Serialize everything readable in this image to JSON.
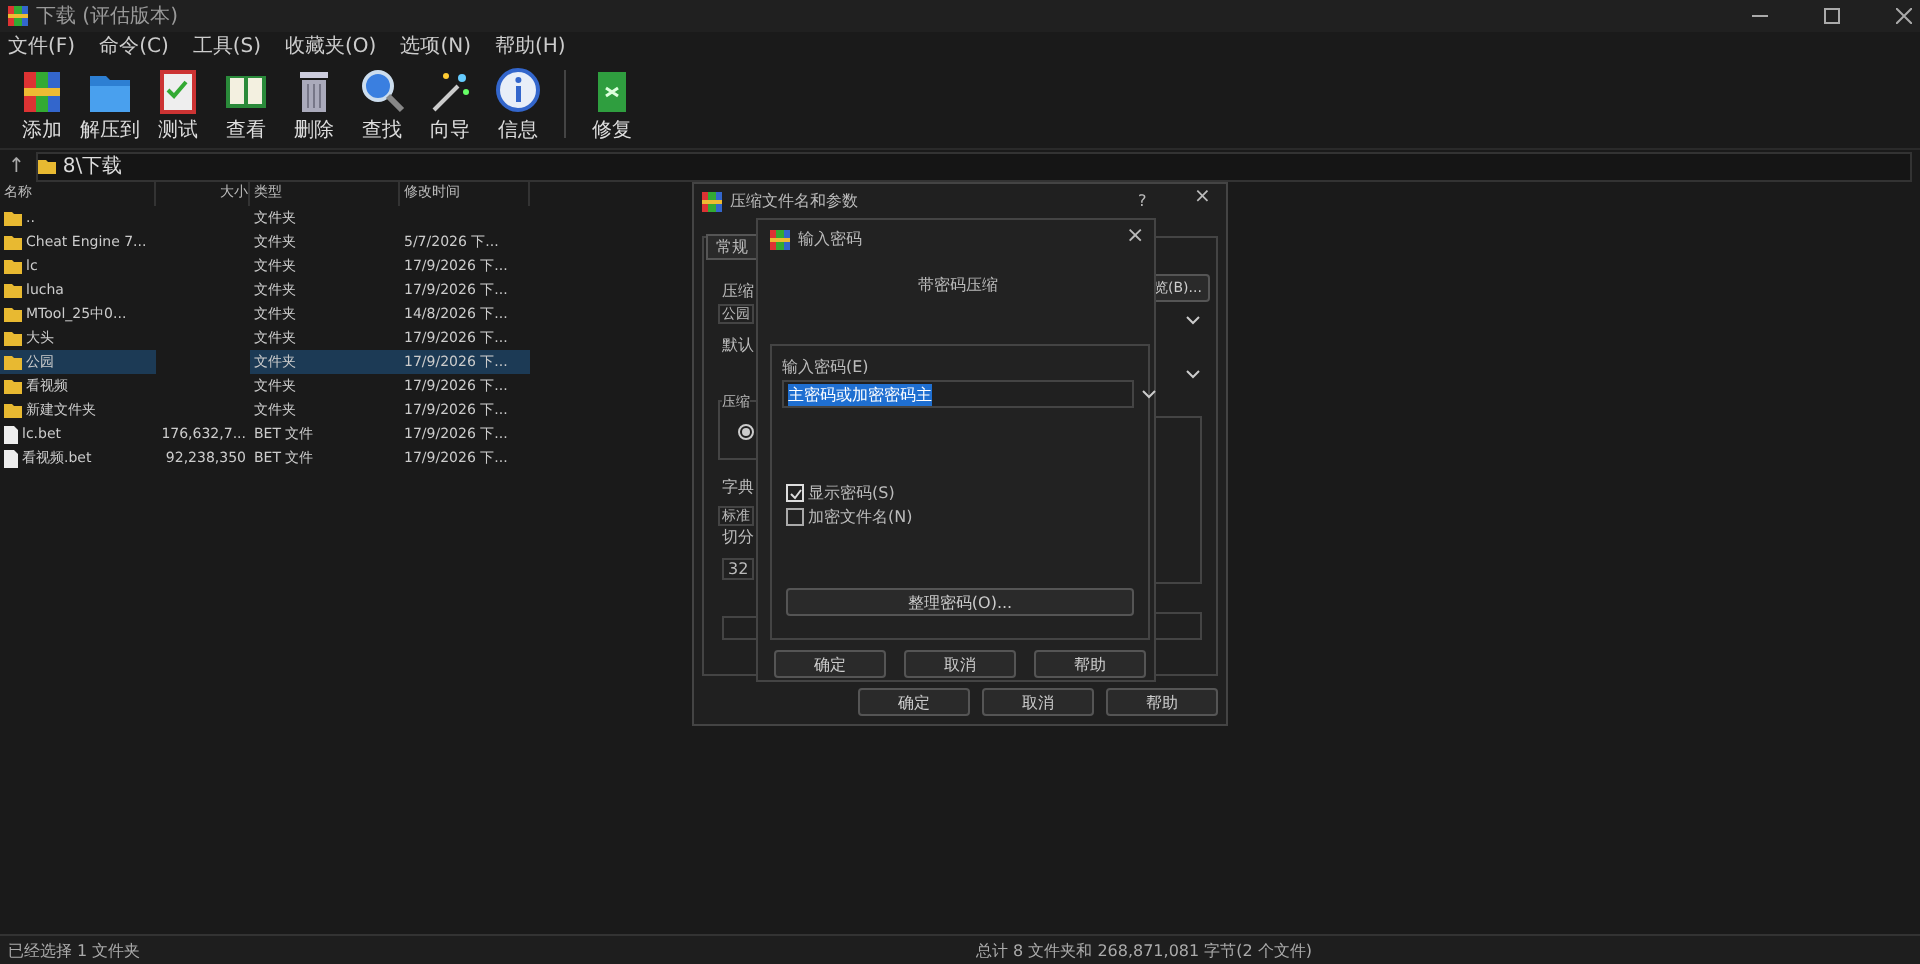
{
  "window": {
    "title": "下载 (评估版本)"
  },
  "menu": [
    "文件(F)",
    "命令(C)",
    "工具(S)",
    "收藏夹(O)",
    "选项(N)",
    "帮助(H)"
  ],
  "toolbar": [
    {
      "kind": "add",
      "label": "添加"
    },
    {
      "kind": "extract",
      "label": "解压到"
    },
    {
      "kind": "test",
      "label": "测试"
    },
    {
      "kind": "view",
      "label": "查看"
    },
    {
      "kind": "delete",
      "label": "删除"
    },
    {
      "kind": "find",
      "label": "查找"
    },
    {
      "kind": "wizard",
      "label": "向导"
    },
    {
      "kind": "info",
      "label": "信息"
    },
    {
      "kind": "repair",
      "label": "修复"
    }
  ],
  "address": {
    "up": "↑",
    "path": "8\\下载"
  },
  "table": {
    "columns": [
      "名称",
      "大小",
      "类型",
      "修改时间"
    ],
    "rows": [
      {
        "kind": "folder",
        "name": "..",
        "size": "",
        "type": "文件夹",
        "modified": "",
        "selected": false
      },
      {
        "kind": "folder",
        "name": "Cheat Engine 7...",
        "size": "",
        "type": "文件夹",
        "modified": "5/7/2026 下...",
        "selected": false
      },
      {
        "kind": "folder",
        "name": "lc",
        "size": "",
        "type": "文件夹",
        "modified": "17/9/2026 下...",
        "selected": false
      },
      {
        "kind": "folder",
        "name": "lucha",
        "size": "",
        "type": "文件夹",
        "modified": "17/9/2026 下...",
        "selected": false
      },
      {
        "kind": "folder",
        "name": "MTool_25中0...",
        "size": "",
        "type": "文件夹",
        "modified": "14/8/2026 下...",
        "selected": false
      },
      {
        "kind": "folder",
        "name": "大头",
        "size": "",
        "type": "文件夹",
        "modified": "17/9/2026 下...",
        "selected": false
      },
      {
        "kind": "folder",
        "name": "公园",
        "size": "",
        "type": "文件夹",
        "modified": "17/9/2026 下...",
        "selected": true
      },
      {
        "kind": "folder",
        "name": "看视频",
        "size": "",
        "type": "文件夹",
        "modified": "17/9/2026 下...",
        "selected": false
      },
      {
        "kind": "folder",
        "name": "新建文件夹",
        "size": "",
        "type": "文件夹",
        "modified": "17/9/2026 下...",
        "selected": false
      },
      {
        "kind": "file",
        "name": "lc.bet",
        "size": "176,632,7...",
        "type": "BET 文件",
        "modified": "17/9/2026 下...",
        "selected": false
      },
      {
        "kind": "file",
        "name": "看视频.bet",
        "size": "92,238,350",
        "type": "BET 文件",
        "modified": "17/9/2026 下...",
        "selected": false
      }
    ]
  },
  "archive_dialog": {
    "title": "压缩文件名和参数",
    "help": "?",
    "close": "×",
    "tab": "常规",
    "labels": [
      "压缩",
      "默认",
      "压缩",
      "字典",
      "切分"
    ],
    "archive_name": "公园",
    "browse": "览(B)...",
    "method": "标准",
    "dictionary": "32",
    "buttons": [
      "确定",
      "取消",
      "帮助"
    ]
  },
  "password_dialog": {
    "title": "输入密码",
    "close": "×",
    "heading": "带密码压缩",
    "field_label": "输入密码(E)",
    "value": "主密码或加密密码主",
    "options": [
      {
        "label": "显示密码(S)",
        "checked": true
      },
      {
        "label": "加密文件名(N)",
        "checked": false
      }
    ],
    "organize": "整理密码(O)...",
    "buttons": [
      "确定",
      "取消",
      "帮助"
    ]
  },
  "status_bar": {
    "left": "已经选择 1 文件夹",
    "right": "总计 8 文件夹和 268,871,081 字节(2 个文件)"
  }
}
